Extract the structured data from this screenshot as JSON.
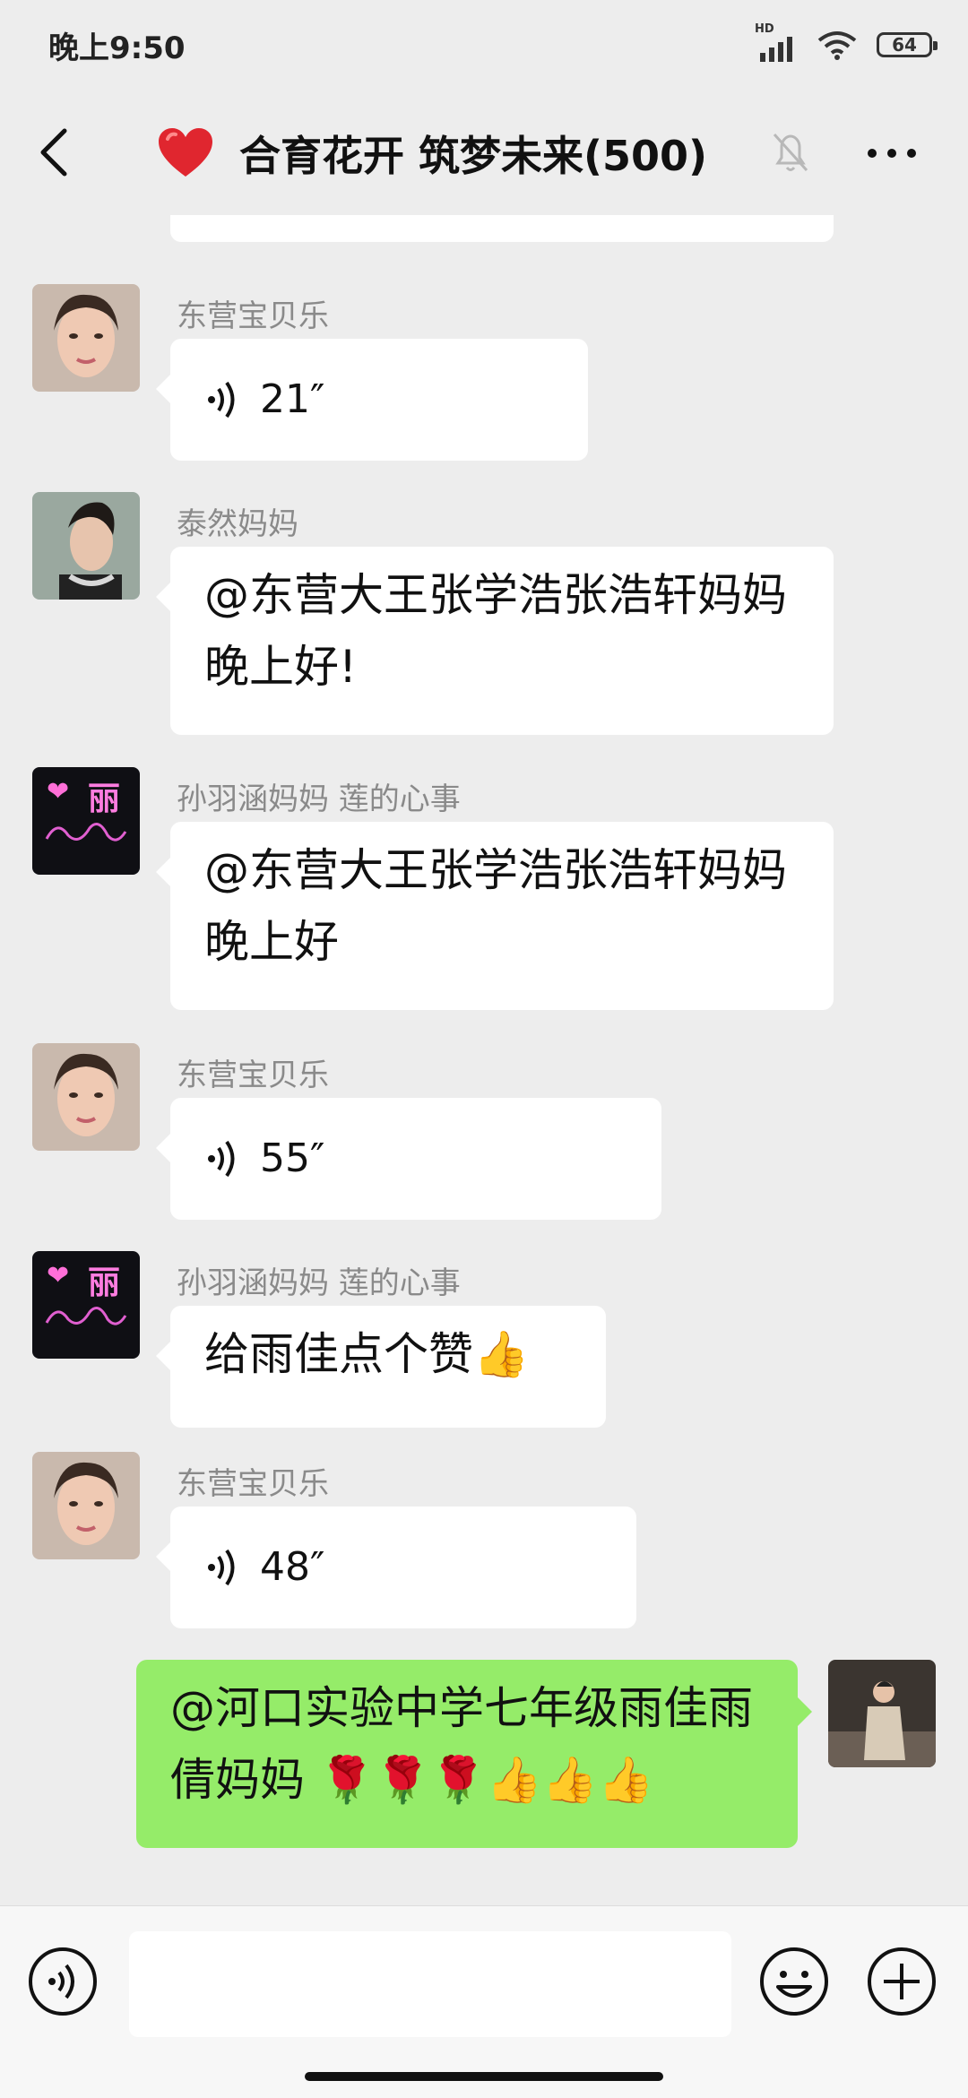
{
  "status_bar": {
    "time": "晚上9:50",
    "battery": "64",
    "network_label": "HD"
  },
  "header": {
    "title": "合育花开 筑梦未来(500)"
  },
  "messages": [
    {
      "sender": "东营宝贝乐",
      "voice_duration": "21″"
    },
    {
      "sender": "泰然妈妈",
      "text": "@东营大王张学浩张浩轩妈妈  晚上好!"
    },
    {
      "sender": "孙羽涵妈妈  莲的心事",
      "text": "@东营大王张学浩张浩轩妈妈  晚上好"
    },
    {
      "sender": "东营宝贝乐",
      "voice_duration": "55″"
    },
    {
      "sender": "孙羽涵妈妈  莲的心事",
      "text": "给雨佳点个赞👍"
    },
    {
      "sender": "东营宝贝乐",
      "voice_duration": "48″"
    },
    {
      "sender": "",
      "text": "@河口实验中学七年级雨佳雨倩妈妈 🌹🌹🌹👍👍👍",
      "self": true
    }
  ],
  "avatar_text": {
    "rain_char": "丽",
    "heart": "❤"
  },
  "colors": {
    "self_bubble": "#95ec69",
    "other_bubble": "#ffffff",
    "background": "#ededed"
  }
}
